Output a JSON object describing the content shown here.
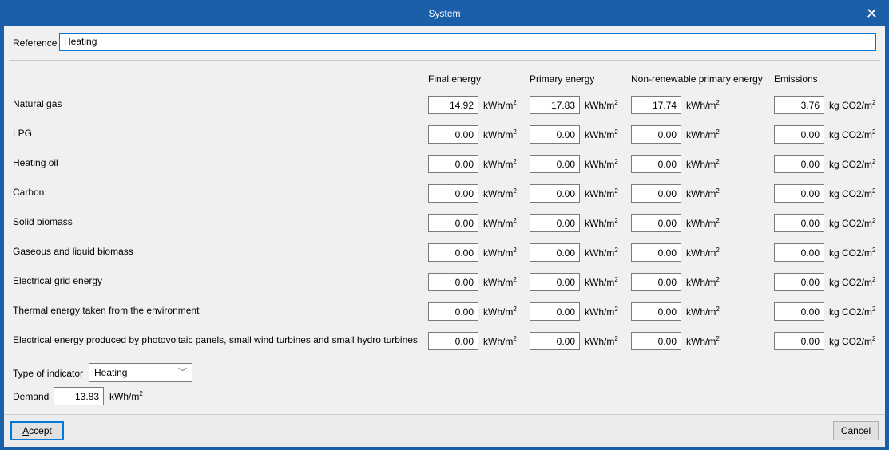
{
  "window": {
    "title": "System",
    "close_icon": "close-icon"
  },
  "reference": {
    "label": "Reference",
    "value": "Heating"
  },
  "columns": [
    "Final energy",
    "Primary energy",
    "Non-renewable primary energy",
    "Emissions"
  ],
  "units": {
    "energy": "kWh/m",
    "energy_sup": "2",
    "emissions": "kg CO2/m",
    "emissions_sup": "2"
  },
  "rows": [
    {
      "label": "Natural gas",
      "values": [
        "14.92",
        "17.83",
        "17.74",
        "3.76"
      ]
    },
    {
      "label": "LPG",
      "values": [
        "0.00",
        "0.00",
        "0.00",
        "0.00"
      ]
    },
    {
      "label": "Heating oil",
      "values": [
        "0.00",
        "0.00",
        "0.00",
        "0.00"
      ]
    },
    {
      "label": "Carbon",
      "values": [
        "0.00",
        "0.00",
        "0.00",
        "0.00"
      ]
    },
    {
      "label": "Solid biomass",
      "values": [
        "0.00",
        "0.00",
        "0.00",
        "0.00"
      ]
    },
    {
      "label": "Gaseous and liquid biomass",
      "values": [
        "0.00",
        "0.00",
        "0.00",
        "0.00"
      ]
    },
    {
      "label": "Electrical grid energy",
      "values": [
        "0.00",
        "0.00",
        "0.00",
        "0.00"
      ]
    },
    {
      "label": "Thermal energy taken from the environment",
      "values": [
        "0.00",
        "0.00",
        "0.00",
        "0.00"
      ]
    },
    {
      "label": "Electrical energy produced by photovoltaic panels, small wind turbines and small hydro turbines",
      "values": [
        "0.00",
        "0.00",
        "0.00",
        "0.00"
      ]
    }
  ],
  "indicator": {
    "label": "Type of indicator",
    "value": "Heating"
  },
  "demand": {
    "label": "Demand",
    "value": "13.83",
    "unit": "kWh/m",
    "unit_sup": "2"
  },
  "buttons": {
    "accept_prefix": "A",
    "accept_rest": "ccept",
    "cancel": "Cancel"
  }
}
